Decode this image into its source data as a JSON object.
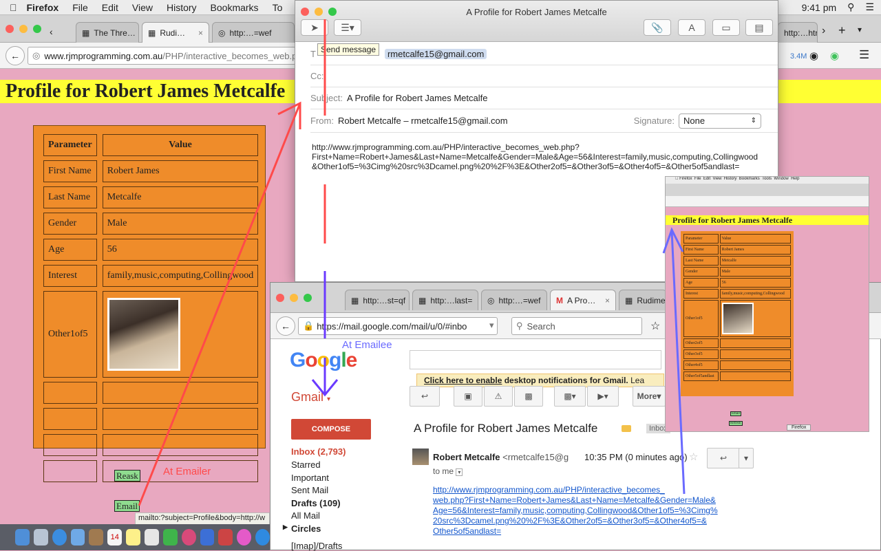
{
  "menubar": {
    "app": "Firefox",
    "items": [
      "File",
      "Edit",
      "View",
      "History",
      "Bookmarks",
      "To"
    ],
    "clock": "9:41 pm"
  },
  "firefox": {
    "tabs": [
      "The Thre…",
      "Rudi…",
      "http:…=wef",
      "http:…htr"
    ],
    "url_domain": "www.rjmprogramming.com.au",
    "url_path": "/PHP/interactive_becomes_web.php",
    "memory": "3.4M"
  },
  "page": {
    "title": "Profile for Robert James Metcalfe",
    "table": {
      "headers": [
        "Parameter",
        "Value"
      ],
      "rows": [
        [
          "First Name",
          "Robert James"
        ],
        [
          "Last Name",
          "Metcalfe"
        ],
        [
          "Gender",
          "Male"
        ],
        [
          "Age",
          "56"
        ],
        [
          "Interest",
          "family,music,computing,Collingwood"
        ]
      ],
      "image_row_label": "Other1of5"
    },
    "reask_label": "Reask",
    "email_label": "Email",
    "status_url": "mailto:?subject=Profile&body=http://w"
  },
  "mail": {
    "window_title": "A Profile for Robert James Metcalfe",
    "tooltip": "Send message",
    "to_value": "rmetcalfe15@gmail.com",
    "cc_label": "Cc:",
    "subject_label": "Subject:",
    "subject_value": "A Profile for Robert James Metcalfe",
    "from_label": "From:",
    "from_value": "Robert Metcalfe – rmetcalfe15@gmail.com",
    "signature_label": "Signature:",
    "signature_value": "None",
    "body_lines": [
      "http://www.rjmprogramming.com.au/PHP/interactive_becomes_web.php?",
      "First+Name=Robert+James&Last+Name=Metcalfe&Gender=Male&Age=56&Interest=family,music,computing,Collingwood",
      "&Other1of5=%3Cimg%20src%3Dcamel.png%20%2F%3E&Other2of5=&Other3of5=&Other4of5=&Other5of5andlast="
    ]
  },
  "gmail": {
    "tabs": [
      "http:…st=qf",
      "http:…last=",
      "http:…=wef",
      "A Pro…",
      "Rudime"
    ],
    "url": "https://mail.google.com/mail/u/0/#inbo",
    "search_placeholder": "Search",
    "notify_link": "Click here to enable",
    "notify_text": "desktop notifications for Gmail.",
    "notify_more": "Lea",
    "gmail_label": "Gmail",
    "compose": "COMPOSE",
    "nav": [
      "Inbox (2,793)",
      "Starred",
      "Important",
      "Sent Mail",
      "Drafts (109)",
      "All Mail",
      "Circles",
      "[Imap]/Drafts"
    ],
    "more_label": "More",
    "subject": "A Profile for Robert James Metcalfe",
    "inbox_tag": "Inbox",
    "sender_name": "Robert Metcalfe",
    "sender_email": "<rmetcalfe15@g",
    "time": "10:35 PM (0 minutes ago)",
    "to_me": "to me",
    "body_link_lines": [
      "http://www.rjmprogramming.com.au/PHP/interactive_becomes_",
      "web.php?First+Name=Robert+James&Last+Name=Metcalfe&Gender=Male&",
      "Age=56&Interest=family,music,computing,Collingwood&Other1of5=%3Cimg%",
      "20src%3Dcamel.png%20%2F%3E&Other2of5=&Other3of5=&Other4of5=&",
      "Other5of5andlast="
    ]
  },
  "mini": {
    "title": "Profile for Robert James Metcalfe",
    "headers": [
      "Parameter",
      "Value"
    ],
    "rows": [
      [
        "First Name",
        "Robert James"
      ],
      [
        "Last Name",
        "Metcalfe"
      ],
      [
        "Gender",
        "Male"
      ],
      [
        "Age",
        "56"
      ],
      [
        "Interest",
        "family,music,computing,Collingwood"
      ]
    ],
    "other_rows": [
      "Other1of5",
      "Other2of5",
      "Other3of5",
      "Other4of5",
      "Other5of5andlast"
    ],
    "buttons": [
      "Email",
      "Refresh"
    ],
    "dock_label": "Firefox"
  },
  "annotations": {
    "emailer": "At Emailer",
    "emailee": "At Emailee"
  },
  "dock_badge": "14"
}
